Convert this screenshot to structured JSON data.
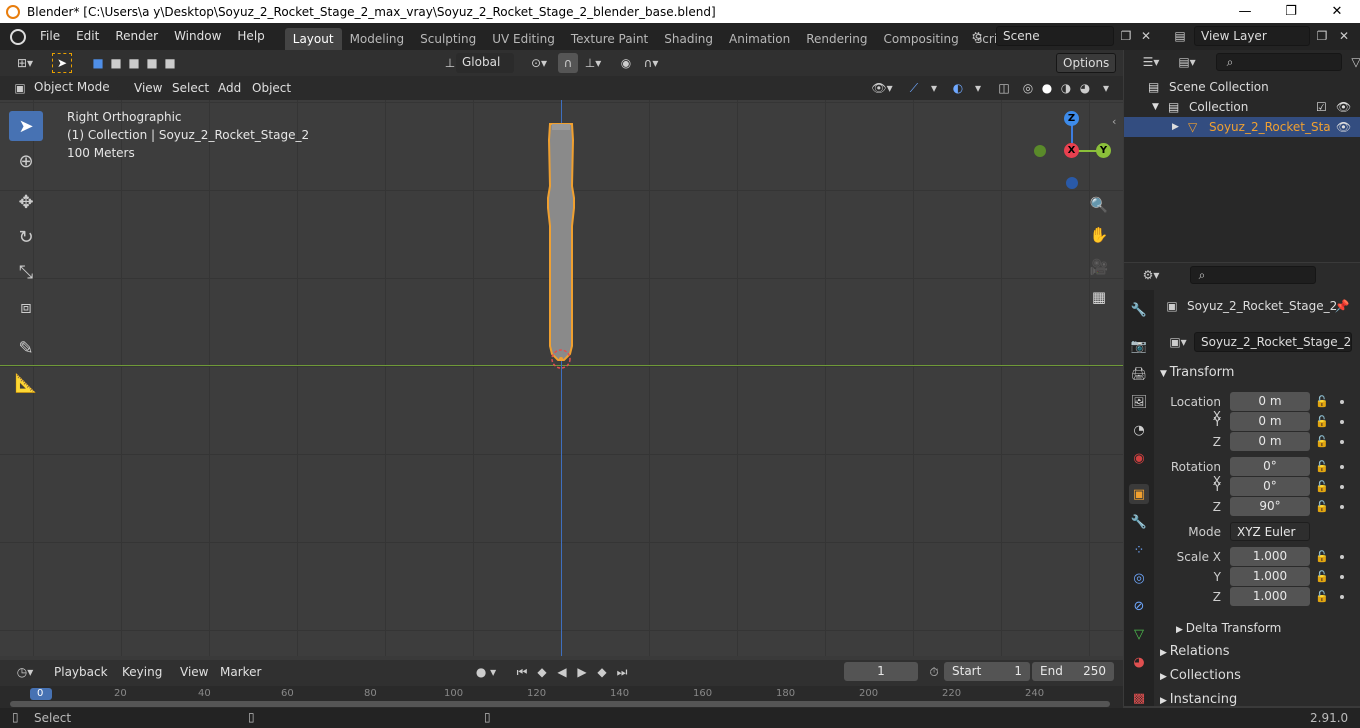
{
  "window": {
    "title": "Blender* [C:\\Users\\a y\\Desktop\\Soyuz_2_Rocket_Stage_2_max_vray\\Soyuz_2_Rocket_Stage_2_blender_base.blend]",
    "controls": [
      "—",
      "❐",
      "✕"
    ]
  },
  "menubar": {
    "items": [
      "File",
      "Edit",
      "Render",
      "Window",
      "Help"
    ],
    "workspaces": [
      "Layout",
      "Modeling",
      "Sculpting",
      "UV Editing",
      "Texture Paint",
      "Shading",
      "Animation",
      "Rendering",
      "Compositing",
      "Scripting"
    ],
    "active_workspace": "Layout",
    "scene": "Scene",
    "view_layer": "View Layer"
  },
  "viewport_header": {
    "transform_orientation": "Global",
    "options_label": "Options",
    "mode": "Object Mode",
    "menus": [
      "View",
      "Select",
      "Add",
      "Object"
    ]
  },
  "viewport": {
    "view_name": "Right Orthographic",
    "collection_info": "(1) Collection | Soyuz_2_Rocket_Stage_2",
    "scale_label": "100 Meters",
    "gizmo": {
      "z": "Z",
      "x": "X",
      "y": "Y"
    }
  },
  "outliner": {
    "scene_collection": "Scene Collection",
    "collection": "Collection",
    "object": "Soyuz_2_Rocket_Sta"
  },
  "properties": {
    "object_name": "Soyuz_2_Rocket_Stage_2",
    "data_name": "Soyuz_2_Rocket_Stage_2",
    "transform_title": "Transform",
    "location": {
      "label": "Location X",
      "x": "0 m",
      "y": "0 m",
      "z": "0 m"
    },
    "rotation": {
      "label": "Rotation X",
      "x": "0°",
      "y": "0°",
      "z": "90°"
    },
    "mode_label": "Mode",
    "mode_value": "XYZ Euler",
    "scale": {
      "label": "Scale X",
      "x": "1.000",
      "y": "1.000",
      "z": "1.000"
    },
    "axis_y": "Y",
    "axis_z": "Z",
    "delta_transform": "Delta Transform",
    "relations": "Relations",
    "collections": "Collections",
    "instancing": "Instancing"
  },
  "timeline": {
    "menus": [
      "Playback",
      "Keying",
      "View",
      "Marker"
    ],
    "current_frame": "1",
    "start_label": "Start",
    "start": "1",
    "end_label": "End",
    "end": "250",
    "ticks": [
      "0",
      "20",
      "40",
      "60",
      "80",
      "100",
      "120",
      "140",
      "160",
      "180",
      "200",
      "220",
      "240"
    ]
  },
  "statusbar": {
    "left": "Select",
    "version": "2.91.0"
  }
}
